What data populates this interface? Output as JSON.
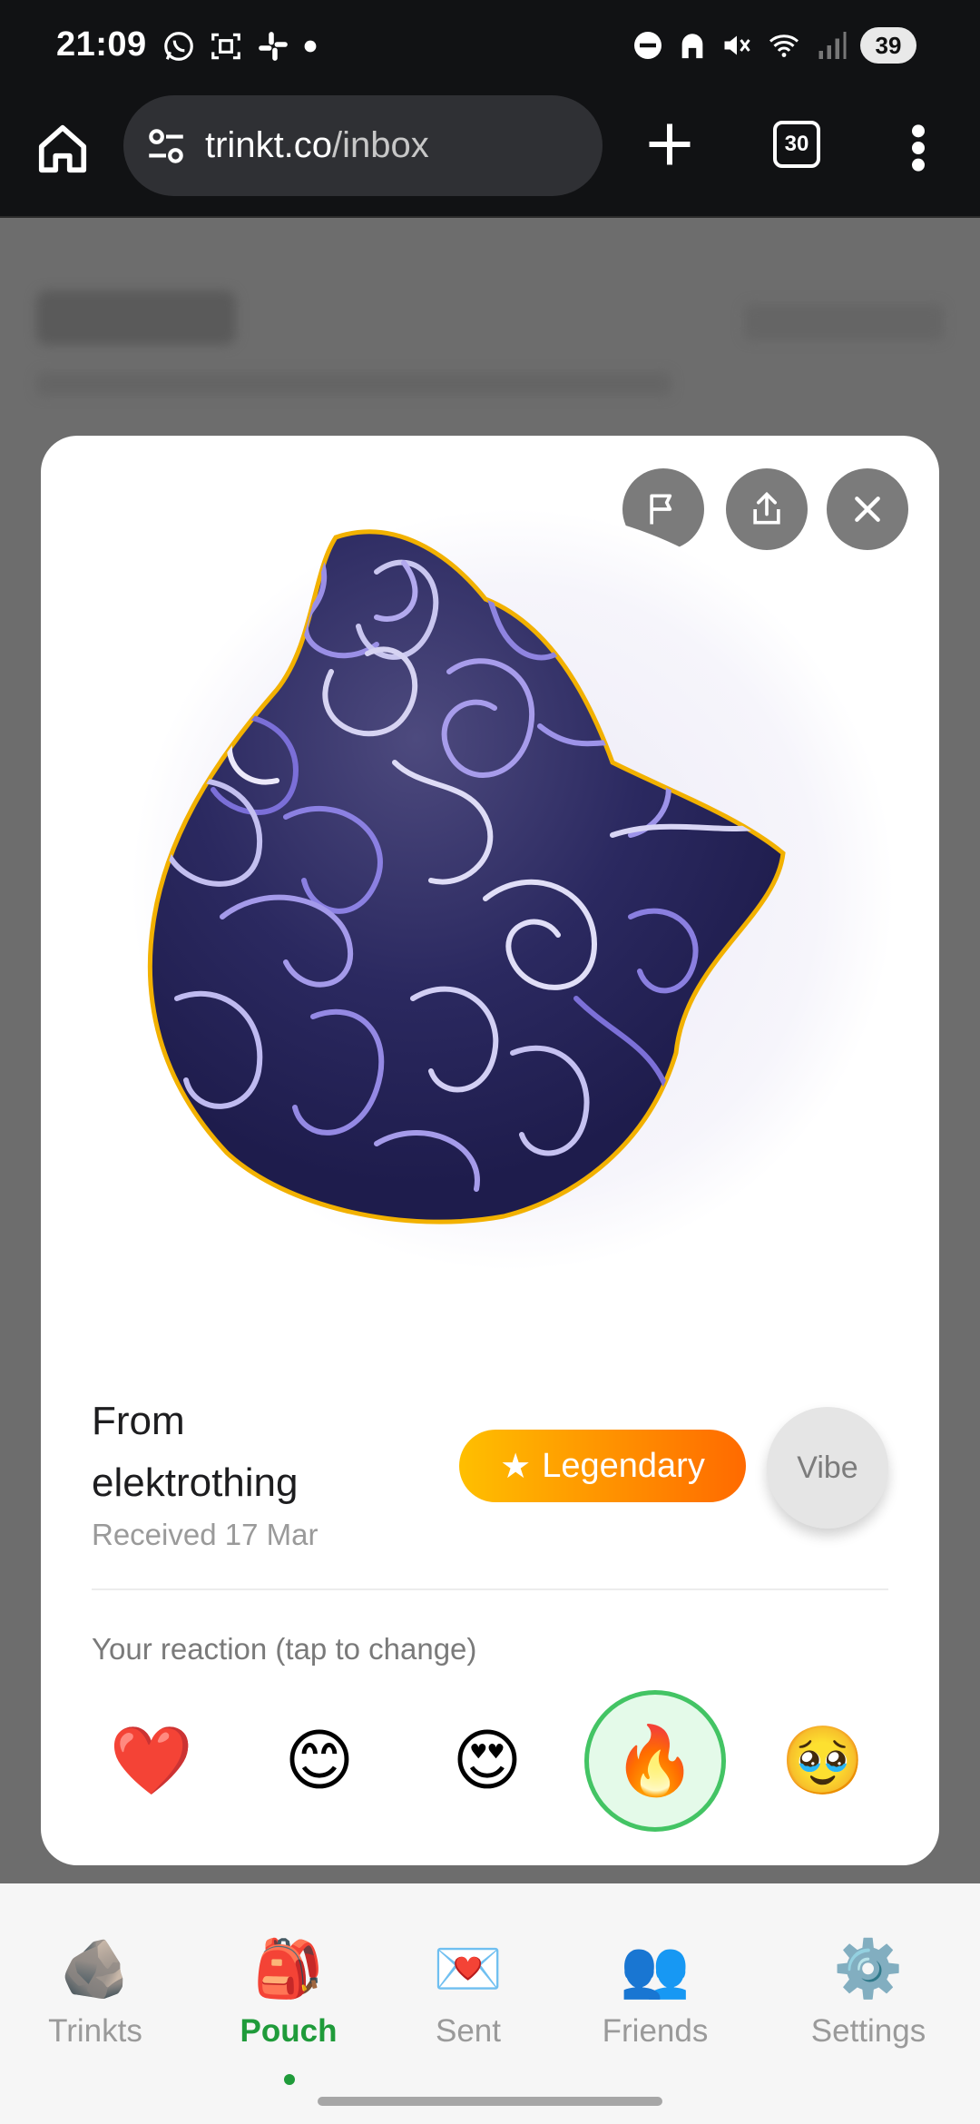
{
  "status": {
    "time": "21:09",
    "battery": "39"
  },
  "browser": {
    "url_domain": "trinkt.co",
    "url_path": "/inbox",
    "tab_count": "30"
  },
  "card": {
    "from_label": "From",
    "sender": "elektrothing",
    "received": "Received 17 Mar",
    "rarity_star": "★",
    "rarity": "Legendary",
    "vibe": "Vibe",
    "reaction_prompt": "Your reaction (tap to change)",
    "reactions": [
      {
        "emoji": "❤️",
        "name": "heart"
      },
      {
        "emoji": "😊",
        "name": "smile"
      },
      {
        "emoji": "😍",
        "name": "heart-eyes"
      },
      {
        "emoji": "🔥",
        "name": "fire",
        "selected": true
      },
      {
        "emoji": "🥹",
        "name": "holding-back-tears"
      }
    ],
    "colors": {
      "stone": "#2c2a5c",
      "stone_outline": "#f2b100",
      "selected_ring": "#43c464"
    }
  },
  "nav": {
    "items": [
      {
        "label": "Trinkts",
        "icon": "🪨"
      },
      {
        "label": "Pouch",
        "icon": "🎒",
        "active": true
      },
      {
        "label": "Sent",
        "icon": "💌"
      },
      {
        "label": "Friends",
        "icon": "👥"
      },
      {
        "label": "Settings",
        "icon": "⚙️"
      }
    ]
  }
}
